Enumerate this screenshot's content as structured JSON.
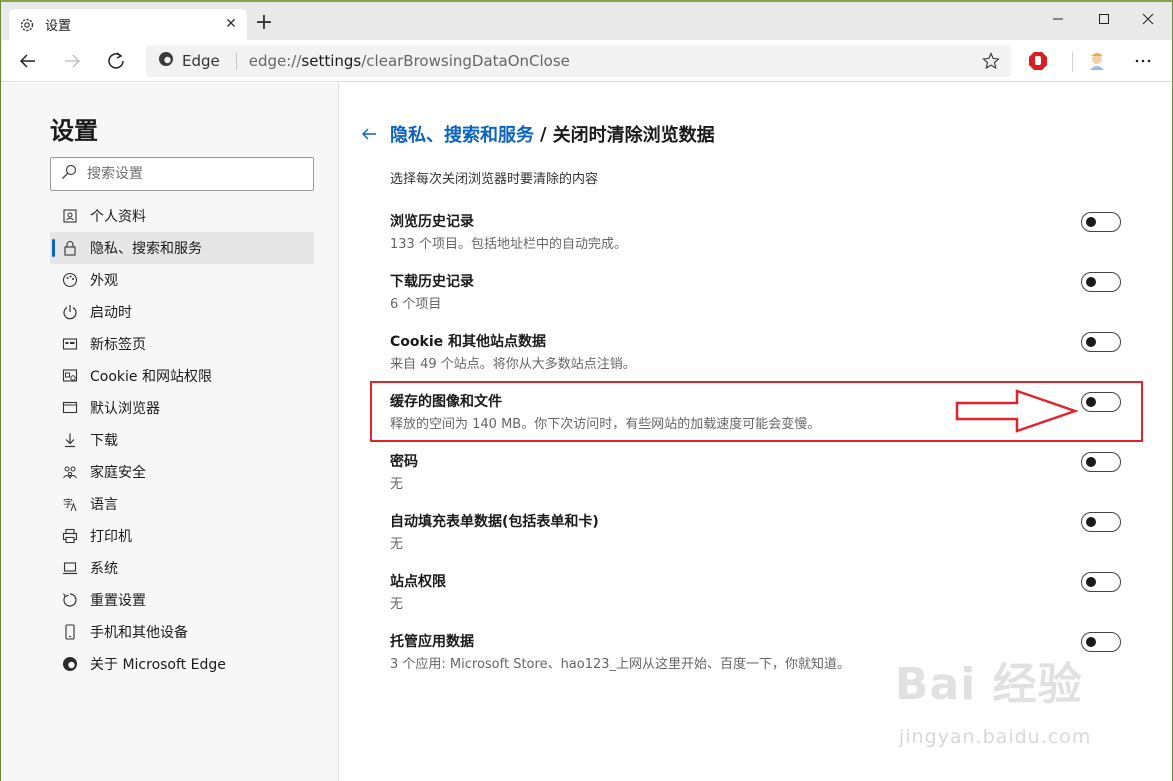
{
  "tab": {
    "title": "设置",
    "icon": "gear-icon"
  },
  "window": {
    "minimize": "minimize-icon",
    "maximize": "maximize-icon",
    "close": "close-icon"
  },
  "address": {
    "brand": "Edge",
    "url_prefix": "edge://",
    "url_host": "settings",
    "url_path": "/clearBrowsingDataOnClose"
  },
  "sidebar": {
    "title": "设置",
    "search_placeholder": "搜索设置",
    "items": [
      {
        "label": "个人资料",
        "icon": "profile-icon"
      },
      {
        "label": "隐私、搜索和服务",
        "icon": "lock-icon",
        "active": true
      },
      {
        "label": "外观",
        "icon": "palette-icon"
      },
      {
        "label": "启动时",
        "icon": "power-icon"
      },
      {
        "label": "新标签页",
        "icon": "newtab-icon"
      },
      {
        "label": "Cookie 和网站权限",
        "icon": "site-permissions-icon"
      },
      {
        "label": "默认浏览器",
        "icon": "browser-icon"
      },
      {
        "label": "下载",
        "icon": "download-icon"
      },
      {
        "label": "家庭安全",
        "icon": "family-icon"
      },
      {
        "label": "语言",
        "icon": "language-icon"
      },
      {
        "label": "打印机",
        "icon": "printer-icon"
      },
      {
        "label": "系统",
        "icon": "system-icon"
      },
      {
        "label": "重置设置",
        "icon": "reset-icon"
      },
      {
        "label": "手机和其他设备",
        "icon": "phone-icon"
      },
      {
        "label": "关于 Microsoft Edge",
        "icon": "edge-logo-icon"
      }
    ]
  },
  "main": {
    "breadcrumb_parent": "隐私、搜索和服务",
    "breadcrumb_sep": "/",
    "breadcrumb_current": "关闭时清除浏览数据",
    "intro": "选择每次关闭浏览器时要清除的内容",
    "rows": [
      {
        "title": "浏览历史记录",
        "desc": "133 个项目。包括地址栏中的自动完成。",
        "on": false
      },
      {
        "title": "下载历史记录",
        "desc": "6 个项目",
        "on": false
      },
      {
        "title": "Cookie 和其他站点数据",
        "desc": "来自 49 个站点。将你从大多数站点注销。",
        "on": false
      },
      {
        "title": "缓存的图像和文件",
        "desc": "释放的空间为 140 MB。你下次访问时，有些网站的加载速度可能会变慢。",
        "on": false
      },
      {
        "title": "密码",
        "desc": "无",
        "on": false
      },
      {
        "title": "自动填充表单数据(包括表单和卡)",
        "desc": "无",
        "on": false
      },
      {
        "title": "站点权限",
        "desc": "无",
        "on": false
      },
      {
        "title": "托管应用数据",
        "desc": "3 个应用: Microsoft Store、hao123_上网从这里开始、百度一下，你就知道。",
        "on": false
      }
    ]
  },
  "watermark": {
    "text": "Bai 经验",
    "sub": "jingyan.baidu.com"
  },
  "colors": {
    "accent": "#0c64c0",
    "highlight": "#e0242c"
  }
}
